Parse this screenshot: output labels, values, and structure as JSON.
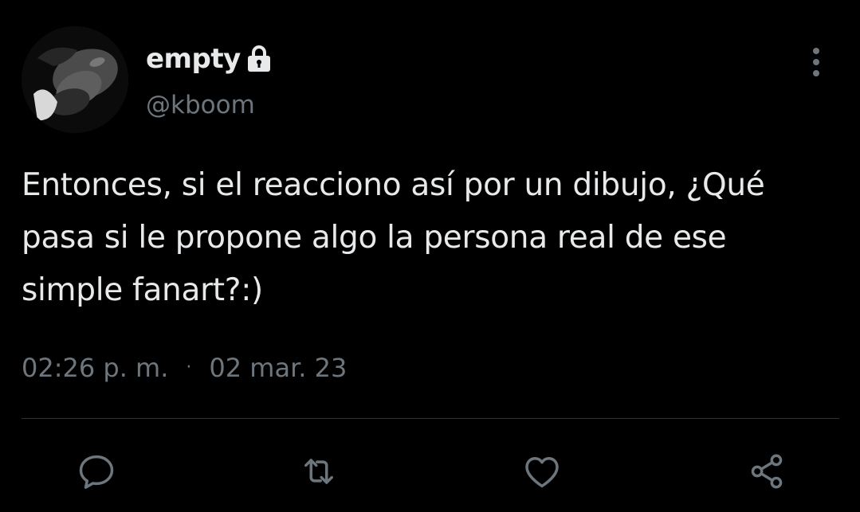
{
  "user": {
    "display_name": "empty",
    "handle": "@kboom",
    "avatar_icon": "profile-photo",
    "protected_icon": "lock-icon"
  },
  "tweet": {
    "text": "Entonces, si el reacciono así por un dibujo, ¿Qué\npasa si le propone algo la persona real de ese\nsimple fanart?:)",
    "time": "02:26 p. m.",
    "separator": "·",
    "date": "02 mar. 23"
  },
  "actions": {
    "reply_icon": "reply-icon",
    "retweet_icon": "retweet-icon",
    "like_icon": "heart-icon",
    "share_icon": "share-icon"
  },
  "colors": {
    "background": "#000000",
    "primary_text": "#e7e9ea",
    "secondary_text": "#6e767d",
    "divider": "#2f3336"
  }
}
